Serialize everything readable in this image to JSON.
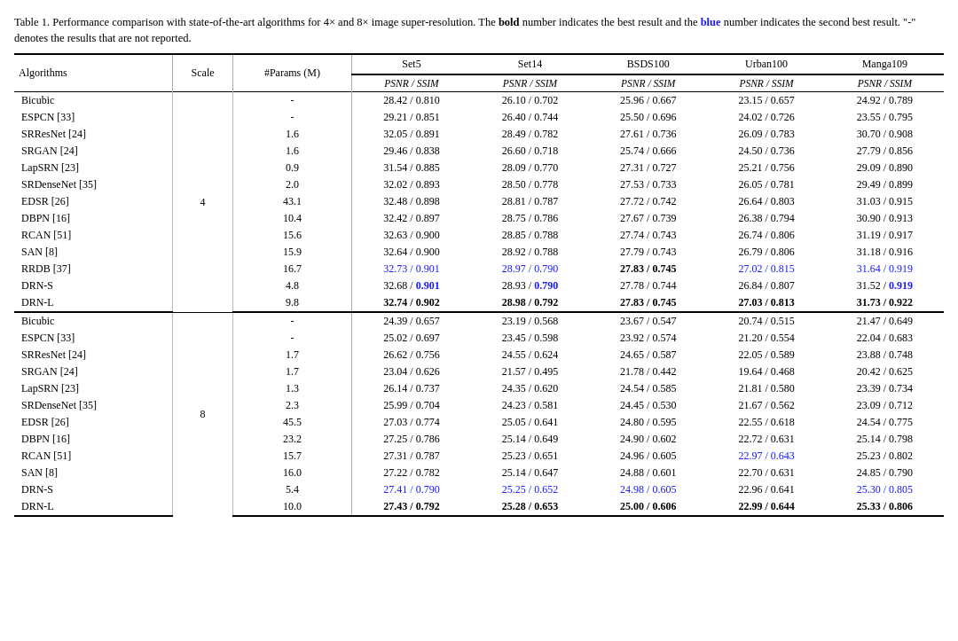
{
  "caption": {
    "prefix": "Table 1. Performance comparison with state-of-the-art algorithms for 4",
    "times1": "×",
    "and": " and 8",
    "times2": "×",
    "suffix": " image super-resolution. The ",
    "bold_text": "bold",
    "middle": " number indicates the best result and the ",
    "blue_text": "blue",
    "end": " number indicates the second best result. \"-\" denotes the results that are not reported."
  },
  "table": {
    "headers": {
      "col1": "Algorithms",
      "col2": "Scale",
      "col3": "#Params (M)",
      "col4_top": "Set5",
      "col4_bot": "PSNR / SSIM",
      "col5_top": "Set14",
      "col5_bot": "PSNR / SSIM",
      "col6_top": "BSDS100",
      "col6_bot": "PSNR / SSIM",
      "col7_top": "Urban100",
      "col7_bot": "PSNR / SSIM",
      "col8_top": "Manga109",
      "col8_bot": "PSNR / SSIM"
    },
    "scale4_rows": [
      {
        "algo": "Bicubic",
        "params": "-",
        "set5": "28.42 / 0.810",
        "set14": "26.10 / 0.702",
        "bsds": "25.96 / 0.667",
        "urban": "23.15 / 0.657",
        "manga": "24.92 / 0.789",
        "set5_style": "",
        "set14_style": "",
        "bsds_style": "",
        "urban_style": "",
        "manga_style": ""
      },
      {
        "algo": "ESPCN [33]",
        "params": "-",
        "set5": "29.21 / 0.851",
        "set14": "26.40 / 0.744",
        "bsds": "25.50 / 0.696",
        "urban": "24.02 / 0.726",
        "manga": "23.55 / 0.795",
        "set5_style": "",
        "set14_style": "",
        "bsds_style": "",
        "urban_style": "",
        "manga_style": ""
      },
      {
        "algo": "SRResNet [24]",
        "params": "1.6",
        "set5": "32.05 / 0.891",
        "set14": "28.49 / 0.782",
        "bsds": "27.61 / 0.736",
        "urban": "26.09 / 0.783",
        "manga": "30.70 / 0.908",
        "set5_style": "",
        "set14_style": "",
        "bsds_style": "",
        "urban_style": "",
        "manga_style": ""
      },
      {
        "algo": "SRGAN [24]",
        "params": "1.6",
        "set5": "29.46 / 0.838",
        "set14": "26.60 / 0.718",
        "bsds": "25.74 / 0.666",
        "urban": "24.50 / 0.736",
        "manga": "27.79 / 0.856",
        "set5_style": "",
        "set14_style": "",
        "bsds_style": "",
        "urban_style": "",
        "manga_style": ""
      },
      {
        "algo": "LapSRN [23]",
        "params": "0.9",
        "set5": "31.54 / 0.885",
        "set14": "28.09 / 0.770",
        "bsds": "27.31 / 0.727",
        "urban": "25.21 / 0.756",
        "manga": "29.09 / 0.890",
        "set5_style": "",
        "set14_style": "",
        "bsds_style": "",
        "urban_style": "",
        "manga_style": ""
      },
      {
        "algo": "SRDenseNet [35]",
        "params": "2.0",
        "set5": "32.02 / 0.893",
        "set14": "28.50 / 0.778",
        "bsds": "27.53 / 0.733",
        "urban": "26.05 / 0.781",
        "manga": "29.49 / 0.899",
        "set5_style": "",
        "set14_style": "",
        "bsds_style": "",
        "urban_style": "",
        "manga_style": ""
      },
      {
        "algo": "EDSR [26]",
        "params": "43.1",
        "set5": "32.48 / 0.898",
        "set14": "28.81 / 0.787",
        "bsds": "27.72 / 0.742",
        "urban": "26.64 / 0.803",
        "manga": "31.03 / 0.915",
        "set5_style": "",
        "set14_style": "",
        "bsds_style": "",
        "urban_style": "",
        "manga_style": ""
      },
      {
        "algo": "DBPN [16]",
        "params": "10.4",
        "set5": "32.42 / 0.897",
        "set14": "28.75 / 0.786",
        "bsds": "27.67 / 0.739",
        "urban": "26.38 / 0.794",
        "manga": "30.90 / 0.913",
        "set5_style": "",
        "set14_style": "",
        "bsds_style": "",
        "urban_style": "",
        "manga_style": ""
      },
      {
        "algo": "RCAN [51]",
        "params": "15.6",
        "set5": "32.63 / 0.900",
        "set14": "28.85 / 0.788",
        "bsds": "27.74 / 0.743",
        "urban": "26.74 / 0.806",
        "manga": "31.19 / 0.917",
        "set5_style": "",
        "set14_style": "",
        "bsds_style": "",
        "urban_style": "",
        "manga_style": ""
      },
      {
        "algo": "SAN [8]",
        "params": "15.9",
        "set5": "32.64 / 0.900",
        "set14": "28.92 / 0.788",
        "bsds": "27.79 / 0.743",
        "urban": "26.79 / 0.806",
        "manga": "31.18 / 0.916",
        "set5_style": "",
        "set14_style": "",
        "bsds_style": "",
        "urban_style": "",
        "manga_style": ""
      },
      {
        "algo": "RRDB [37]",
        "params": "16.7",
        "set5": "32.73 / 0.901",
        "set14": "28.97 / 0.790",
        "bsds": "27.83 / 0.745",
        "urban": "27.02 / 0.815",
        "manga": "31.64 / 0.919",
        "set5_style": "blue",
        "set14_style": "blue",
        "bsds_style": "bold",
        "urban_style": "blue",
        "manga_style": "blue"
      },
      {
        "algo": "DRN-S",
        "params": "4.8",
        "set5": "32.68 / 0.901",
        "set14": "28.93 / 0.790",
        "bsds": "27.78 / 0.744",
        "urban": "26.84 / 0.807",
        "manga": "31.52 / 0.919",
        "set5_style": "",
        "set5_second": "0.901",
        "set14_style": "",
        "set14_second": "0.790",
        "bsds_style": "",
        "urban_style": "",
        "manga_style": "",
        "manga_second": "0.919"
      },
      {
        "algo": "DRN-L",
        "params": "9.8",
        "set5": "32.74 / 0.902",
        "set14": "28.98 / 0.792",
        "bsds": "27.83 / 0.745",
        "urban": "27.03 / 0.813",
        "manga": "31.73 / 0.922",
        "set5_style": "bold",
        "set14_style": "bold",
        "bsds_style": "bold",
        "urban_style": "bold",
        "manga_style": "bold"
      }
    ],
    "scale8_rows": [
      {
        "algo": "Bicubic",
        "params": "-",
        "set5": "24.39 / 0.657",
        "set14": "23.19 / 0.568",
        "bsds": "23.67 / 0.547",
        "urban": "20.74 / 0.515",
        "manga": "21.47 / 0.649",
        "set5_style": "",
        "set14_style": "",
        "bsds_style": "",
        "urban_style": "",
        "manga_style": ""
      },
      {
        "algo": "ESPCN [33]",
        "params": "-",
        "set5": "25.02 / 0.697",
        "set14": "23.45 / 0.598",
        "bsds": "23.92 / 0.574",
        "urban": "21.20 / 0.554",
        "manga": "22.04 / 0.683",
        "set5_style": "",
        "set14_style": "",
        "bsds_style": "",
        "urban_style": "",
        "manga_style": ""
      },
      {
        "algo": "SRResNet [24]",
        "params": "1.7",
        "set5": "26.62 / 0.756",
        "set14": "24.55 / 0.624",
        "bsds": "24.65 / 0.587",
        "urban": "22.05 / 0.589",
        "manga": "23.88 / 0.748",
        "set5_style": "",
        "set14_style": "",
        "bsds_style": "",
        "urban_style": "",
        "manga_style": ""
      },
      {
        "algo": "SRGAN [24]",
        "params": "1.7",
        "set5": "23.04 / 0.626",
        "set14": "21.57 / 0.495",
        "bsds": "21.78 / 0.442",
        "urban": "19.64 / 0.468",
        "manga": "20.42 / 0.625",
        "set5_style": "",
        "set14_style": "",
        "bsds_style": "",
        "urban_style": "",
        "manga_style": ""
      },
      {
        "algo": "LapSRN [23]",
        "params": "1.3",
        "set5": "26.14 / 0.737",
        "set14": "24.35 / 0.620",
        "bsds": "24.54 / 0.585",
        "urban": "21.81 / 0.580",
        "manga": "23.39 / 0.734",
        "set5_style": "",
        "set14_style": "",
        "bsds_style": "",
        "urban_style": "",
        "manga_style": ""
      },
      {
        "algo": "SRDenseNet [35]",
        "params": "2.3",
        "set5": "25.99 / 0.704",
        "set14": "24.23 / 0.581",
        "bsds": "24.45 / 0.530",
        "urban": "21.67 / 0.562",
        "manga": "23.09 / 0.712",
        "set5_style": "",
        "set14_style": "",
        "bsds_style": "",
        "urban_style": "",
        "manga_style": ""
      },
      {
        "algo": "EDSR [26]",
        "params": "45.5",
        "set5": "27.03 / 0.774",
        "set14": "25.05 / 0.641",
        "bsds": "24.80 / 0.595",
        "urban": "22.55 / 0.618",
        "manga": "24.54 / 0.775",
        "set5_style": "",
        "set14_style": "",
        "bsds_style": "",
        "urban_style": "",
        "manga_style": ""
      },
      {
        "algo": "DBPN [16]",
        "params": "23.2",
        "set5": "27.25 / 0.786",
        "set14": "25.14 / 0.649",
        "bsds": "24.90 / 0.602",
        "urban": "22.72 / 0.631",
        "manga": "25.14 / 0.798",
        "set5_style": "",
        "set14_style": "",
        "bsds_style": "",
        "urban_style": "",
        "manga_style": ""
      },
      {
        "algo": "RCAN [51]",
        "params": "15.7",
        "set5": "27.31 / 0.787",
        "set14": "25.23 / 0.651",
        "bsds": "24.96 / 0.605",
        "urban": "22.97 / 0.643",
        "manga": "25.23 / 0.802",
        "set5_style": "",
        "set14_style": "",
        "bsds_style": "",
        "urban_style": "blue",
        "manga_style": ""
      },
      {
        "algo": "SAN [8]",
        "params": "16.0",
        "set5": "27.22 / 0.782",
        "set14": "25.14 / 0.647",
        "bsds": "24.88 / 0.601",
        "urban": "22.70 / 0.631",
        "manga": "24.85 / 0.790",
        "set5_style": "",
        "set14_style": "",
        "bsds_style": "",
        "urban_style": "",
        "manga_style": ""
      },
      {
        "algo": "DRN-S",
        "params": "5.4",
        "set5": "27.41 / 0.790",
        "set14": "25.25 / 0.652",
        "bsds": "24.98 / 0.605",
        "urban": "22.96 / 0.641",
        "manga": "25.30 / 0.805",
        "set5_style": "blue",
        "set14_style": "blue",
        "bsds_style": "blue",
        "urban_style": "",
        "manga_style": "blue"
      },
      {
        "algo": "DRN-L",
        "params": "10.0",
        "set5": "27.43 / 0.792",
        "set14": "25.28 / 0.653",
        "bsds": "25.00 / 0.606",
        "urban": "22.99 / 0.644",
        "manga": "25.33 / 0.806",
        "set5_style": "bold",
        "set14_style": "bold",
        "bsds_style": "bold",
        "urban_style": "bold",
        "manga_style": "bold"
      }
    ]
  }
}
